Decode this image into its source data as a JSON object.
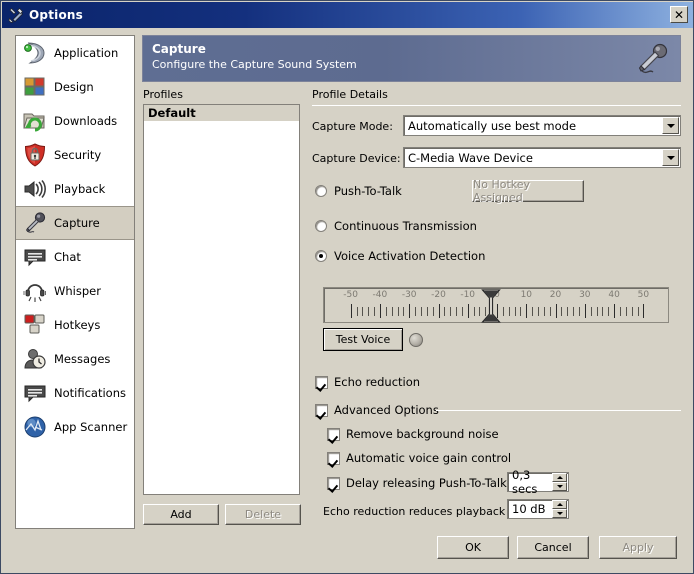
{
  "window": {
    "title": "Options",
    "title_icon": "tools-icon",
    "close_label": "✕"
  },
  "sidebar": {
    "items": [
      {
        "label": "Application",
        "icon": "application-icon",
        "selected": false
      },
      {
        "label": "Design",
        "icon": "design-icon",
        "selected": false
      },
      {
        "label": "Downloads",
        "icon": "downloads-icon",
        "selected": false
      },
      {
        "label": "Security",
        "icon": "security-shield-icon",
        "selected": false
      },
      {
        "label": "Playback",
        "icon": "speaker-icon",
        "selected": false
      },
      {
        "label": "Capture",
        "icon": "microphone-icon",
        "selected": true
      },
      {
        "label": "Chat",
        "icon": "chat-bubble-icon",
        "selected": false
      },
      {
        "label": "Whisper",
        "icon": "headset-icon",
        "selected": false
      },
      {
        "label": "Hotkeys",
        "icon": "hotkeys-icon",
        "selected": false
      },
      {
        "label": "Messages",
        "icon": "messages-icon",
        "selected": false
      },
      {
        "label": "Notifications",
        "icon": "notifications-icon",
        "selected": false
      },
      {
        "label": "App Scanner",
        "icon": "app-scanner-icon",
        "selected": false
      }
    ]
  },
  "banner": {
    "title": "Capture",
    "subtitle": "Configure the Capture Sound System",
    "icon": "microphone-icon"
  },
  "profiles": {
    "label": "Profiles",
    "items": [
      "Default"
    ],
    "add_label": "Add",
    "delete_label": "Delete",
    "delete_enabled": false
  },
  "details": {
    "label": "Profile Details",
    "capture_mode_label": "Capture Mode:",
    "capture_mode_value": "Automatically use best mode",
    "capture_device_label": "Capture Device:",
    "capture_device_value": "C-Media Wave Device",
    "mode_options": [
      {
        "label": "Push-To-Talk",
        "selected": false
      },
      {
        "label": "Continuous Transmission",
        "selected": false
      },
      {
        "label": "Voice Activation Detection",
        "selected": true
      }
    ],
    "hotkey_button_label": "No Hotkey Assigned",
    "hotkey_button_enabled": false,
    "test_voice_label": "Test Voice",
    "led_state": "off"
  },
  "meter": {
    "min": -55,
    "max": 55,
    "thumb_value": -2,
    "tick_labels": [
      "-50",
      "-40",
      "-30",
      "-20",
      "-10",
      "0",
      "10",
      "20",
      "30",
      "40",
      "50"
    ],
    "tick_label_values": [
      -50,
      -40,
      -30,
      -20,
      -10,
      0,
      10,
      20,
      30,
      40,
      50
    ],
    "major_ticks": [
      -50,
      -40,
      -30,
      -20,
      -10,
      0,
      10,
      20,
      30,
      40,
      50
    ],
    "minor_step": 2
  },
  "options": {
    "echo_reduction": {
      "label": "Echo reduction",
      "checked": true
    },
    "advanced": {
      "label": "Advanced Options",
      "checked": true
    },
    "remove_noise": {
      "label": "Remove background noise",
      "checked": true
    },
    "auto_gain": {
      "label": "Automatic voice gain control",
      "checked": true
    },
    "delay_ptt": {
      "label": "Delay releasing Push-To-Talk:",
      "checked": true,
      "value": "0,3 secs"
    },
    "echo_playback": {
      "label": "Echo reduction reduces playback by:",
      "value": "10 dB"
    }
  },
  "footer": {
    "ok_label": "OK",
    "cancel_label": "Cancel",
    "apply_label": "Apply",
    "apply_enabled": false
  },
  "colors": {
    "face": "#d6d2c6",
    "title_start": "#0a246a",
    "banner_start": "#5f6e93",
    "selected_row": "#d3cec1"
  }
}
